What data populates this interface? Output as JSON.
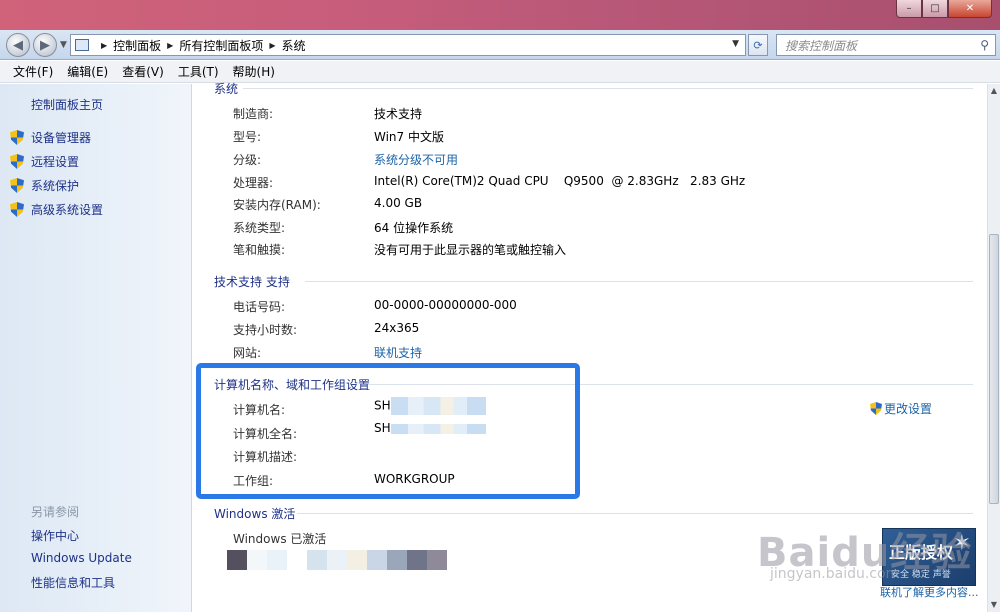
{
  "window": {
    "minimize_label": "–",
    "maximize_label": "□",
    "close_label": "✕"
  },
  "address": {
    "breadcrumbs": [
      "控制面板",
      "所有控制面板项",
      "系统"
    ],
    "search_placeholder": "搜索控制面板"
  },
  "menu": [
    "文件(F)",
    "编辑(E)",
    "查看(V)",
    "工具(T)",
    "帮助(H)"
  ],
  "sidebar": {
    "home": "控制面板主页",
    "tasks": [
      "设备管理器",
      "远程设置",
      "系统保护",
      "高级系统设置"
    ],
    "see_also_title": "另请参阅",
    "see_also": [
      "操作中心",
      "Windows Update",
      "性能信息和工具"
    ]
  },
  "system": {
    "title": "系统",
    "rows": [
      {
        "label": "制造商:",
        "value": "技术支持"
      },
      {
        "label": "型号:",
        "value": "Win7 中文版"
      },
      {
        "label": "分级:",
        "value": "系统分级不可用"
      },
      {
        "label": "处理器:",
        "value": "Intel(R) Core(TM)2 Quad CPU    Q9500  @ 2.83GHz   2.83 GHz"
      },
      {
        "label": "安装内存(RAM):",
        "value": "4.00 GB"
      },
      {
        "label": "系统类型:",
        "value": "64 位操作系统"
      },
      {
        "label": "笔和触摸:",
        "value": "没有可用于此显示器的笔或触控输入"
      }
    ]
  },
  "support": {
    "title": "技术支持 支持",
    "rows": [
      {
        "label": "电话号码:",
        "value": "00-0000-00000000-000"
      },
      {
        "label": "支持小时数:",
        "value": "24x365"
      },
      {
        "label": "网站:",
        "value": "联机支持"
      }
    ]
  },
  "computer": {
    "title": "计算机名称、域和工作组设置",
    "rows": [
      {
        "label": "计算机名:",
        "value": "SH"
      },
      {
        "label": "计算机全名:",
        "value": "SH"
      },
      {
        "label": "计算机描述:",
        "value": ""
      },
      {
        "label": "工作组:",
        "value": "WORKGROUP"
      }
    ],
    "change_settings": "更改设置"
  },
  "activation": {
    "title": "Windows 激活",
    "status": "Windows 已激活",
    "genuine_title": "正版授权",
    "genuine_sub": "安全 稳定 声誉",
    "more_online": "联机了解更多内容..."
  },
  "watermark": {
    "main": "Baidu经验",
    "sub": "jingyan.baidu.com"
  }
}
